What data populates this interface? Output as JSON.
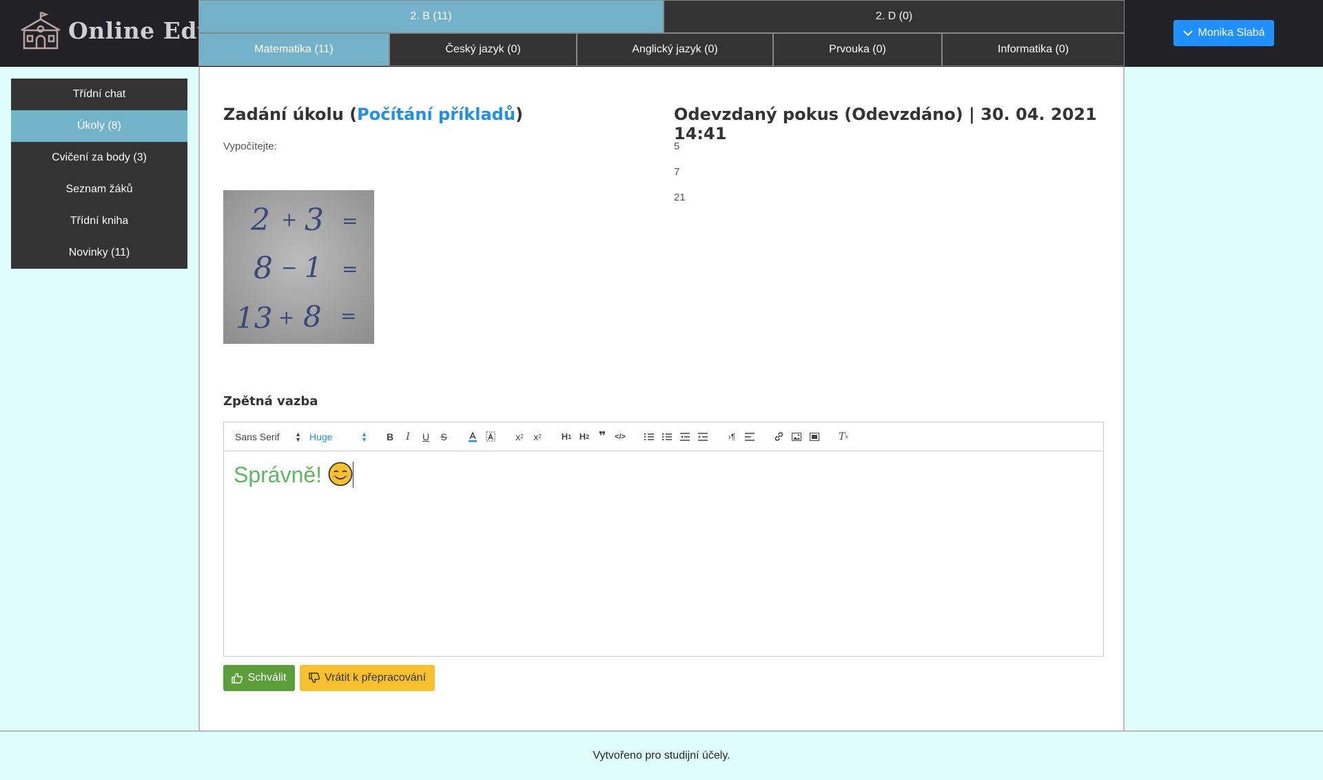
{
  "app": {
    "title": "Online Edu",
    "logo_icon": "school-building-icon"
  },
  "classes": [
    {
      "label": "2. B (11)",
      "active": true
    },
    {
      "label": "2. D (0)",
      "active": false
    }
  ],
  "subjects": [
    {
      "label": "Matematika (11)",
      "active": true
    },
    {
      "label": "Český jazyk (0)",
      "active": false
    },
    {
      "label": "Anglický jazyk (0)",
      "active": false
    },
    {
      "label": "Prvouka (0)",
      "active": false
    },
    {
      "label": "Informatika (0)",
      "active": false
    }
  ],
  "user": {
    "name": "Monika Slabá",
    "icon": "chevron-down-icon"
  },
  "sidebar": {
    "items": [
      {
        "label": "Třídní chat",
        "active": false
      },
      {
        "label": "Úkoly (8)",
        "active": true
      },
      {
        "label": "Cvičení za body (3)",
        "active": false
      },
      {
        "label": "Seznam žáků",
        "active": false
      },
      {
        "label": "Třídní kniha",
        "active": false
      },
      {
        "label": "Novinky (11)",
        "active": false
      }
    ]
  },
  "task": {
    "title_prefix": "Zadání úkolu (",
    "title_link": "Počítání příkladů",
    "title_suffix": ")",
    "text": "Vypočítejte:",
    "image_lines": [
      "2 + 3 =",
      "8 − 1 =",
      "13 + 8 ="
    ]
  },
  "attempt": {
    "title": "Odevzdaný pokus (Odevzdáno) | 30. 04. 2021 14:41",
    "answers": [
      "5",
      "7",
      "21"
    ]
  },
  "feedback": {
    "label": "Zpětná vazba",
    "font": "Sans Serif",
    "size": "Huge",
    "content": "Správně!",
    "content_color": "#5cb85c",
    "emoji": "smiling-face-emoji"
  },
  "actions": {
    "approve": "Schválit",
    "return": "Vrátit k přepracování",
    "approve_color": "#5a9e3a",
    "return_color": "#f9c02e"
  },
  "footer": {
    "text": "Vytvořeno pro studijní účely."
  }
}
